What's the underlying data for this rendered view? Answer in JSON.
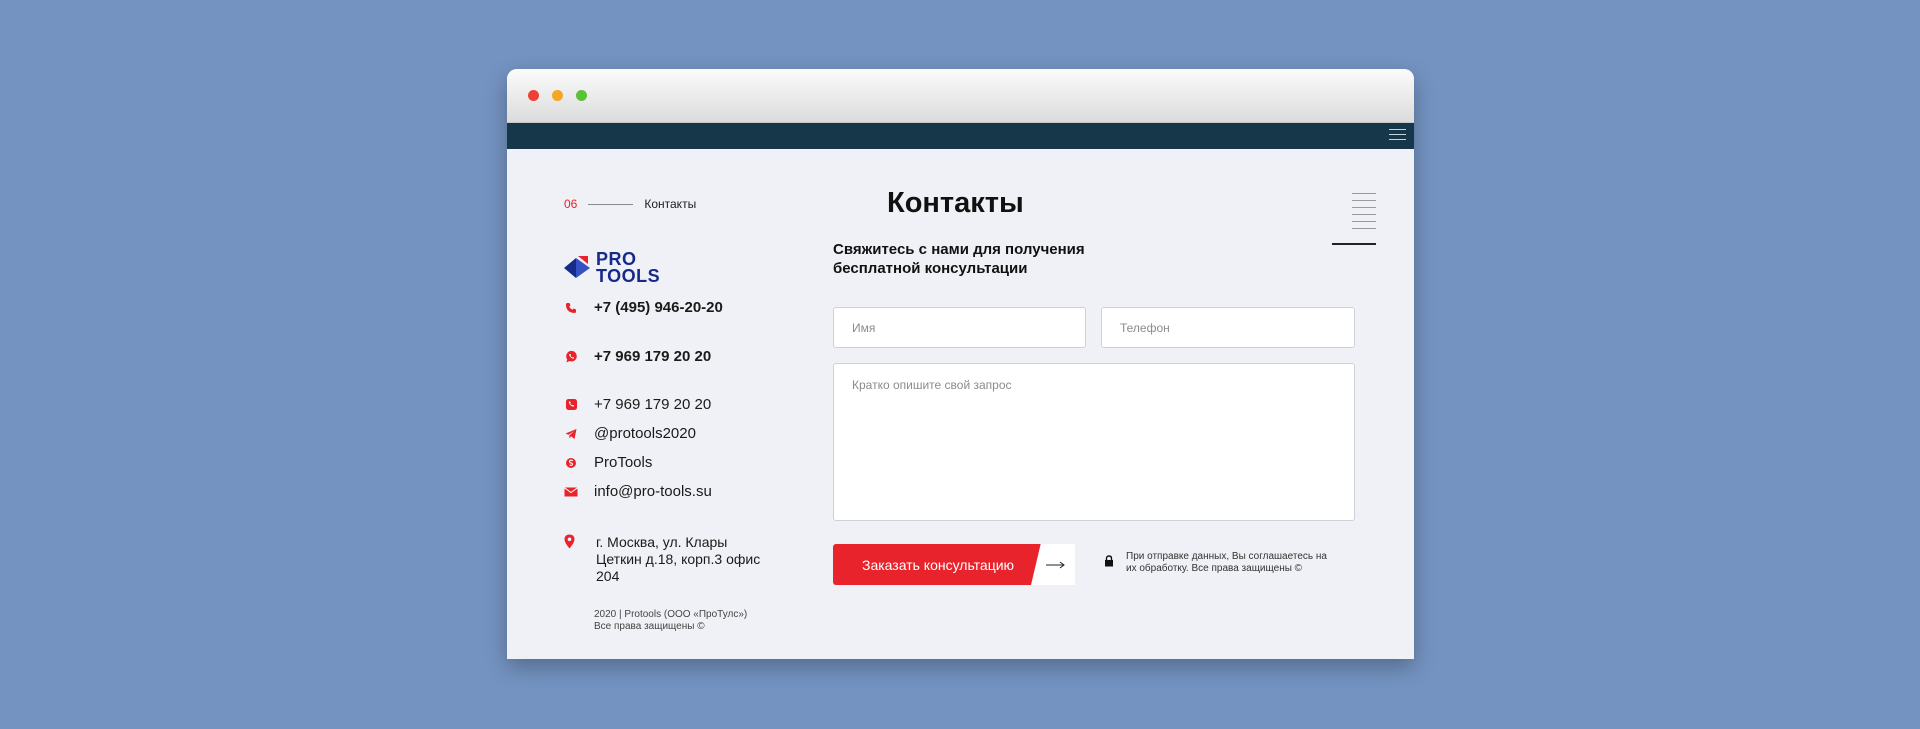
{
  "breadcrumb": {
    "number": "06",
    "label": "Контакты"
  },
  "page": {
    "title": "Контакты"
  },
  "logo": {
    "line1": "PRO",
    "line2": "TOOLS"
  },
  "contacts": {
    "phone_main": "+7 (495) 946-20-20",
    "whatsapp": "+7 969 179 20 20",
    "viber": "+7 969 179 20 20",
    "telegram": "@protools2020",
    "skype": "ProTools",
    "email": "info@pro-tools.su",
    "address": "г. Москва, ул. Клары Цеткин д.18, корп.3 офис 204"
  },
  "footer": {
    "line1": "2020 | Protools (ООО «ПроТулс»)",
    "line2": "Все права защищены ©"
  },
  "form": {
    "heading": "Свяжитесь с нами для получения бесплатной консультации",
    "name_placeholder": "Имя",
    "phone_placeholder": "Телефон",
    "message_placeholder": "Кратко опишите свой запрос",
    "submit_label": "Заказать консультацию",
    "consent": "При отправке данных, Вы соглашаетесь на их обработку. Все права защищены ©"
  },
  "colors": {
    "accent": "#e8232b",
    "navbar": "#16364a",
    "logo": "#162a8a",
    "background": "#7493c1"
  },
  "icons": [
    "phone-icon",
    "whatsapp-icon",
    "viber-icon",
    "telegram-icon",
    "skype-icon",
    "mail-icon",
    "location-pin-icon",
    "lock-icon",
    "arrow-right-icon",
    "hamburger-menu-icon"
  ]
}
